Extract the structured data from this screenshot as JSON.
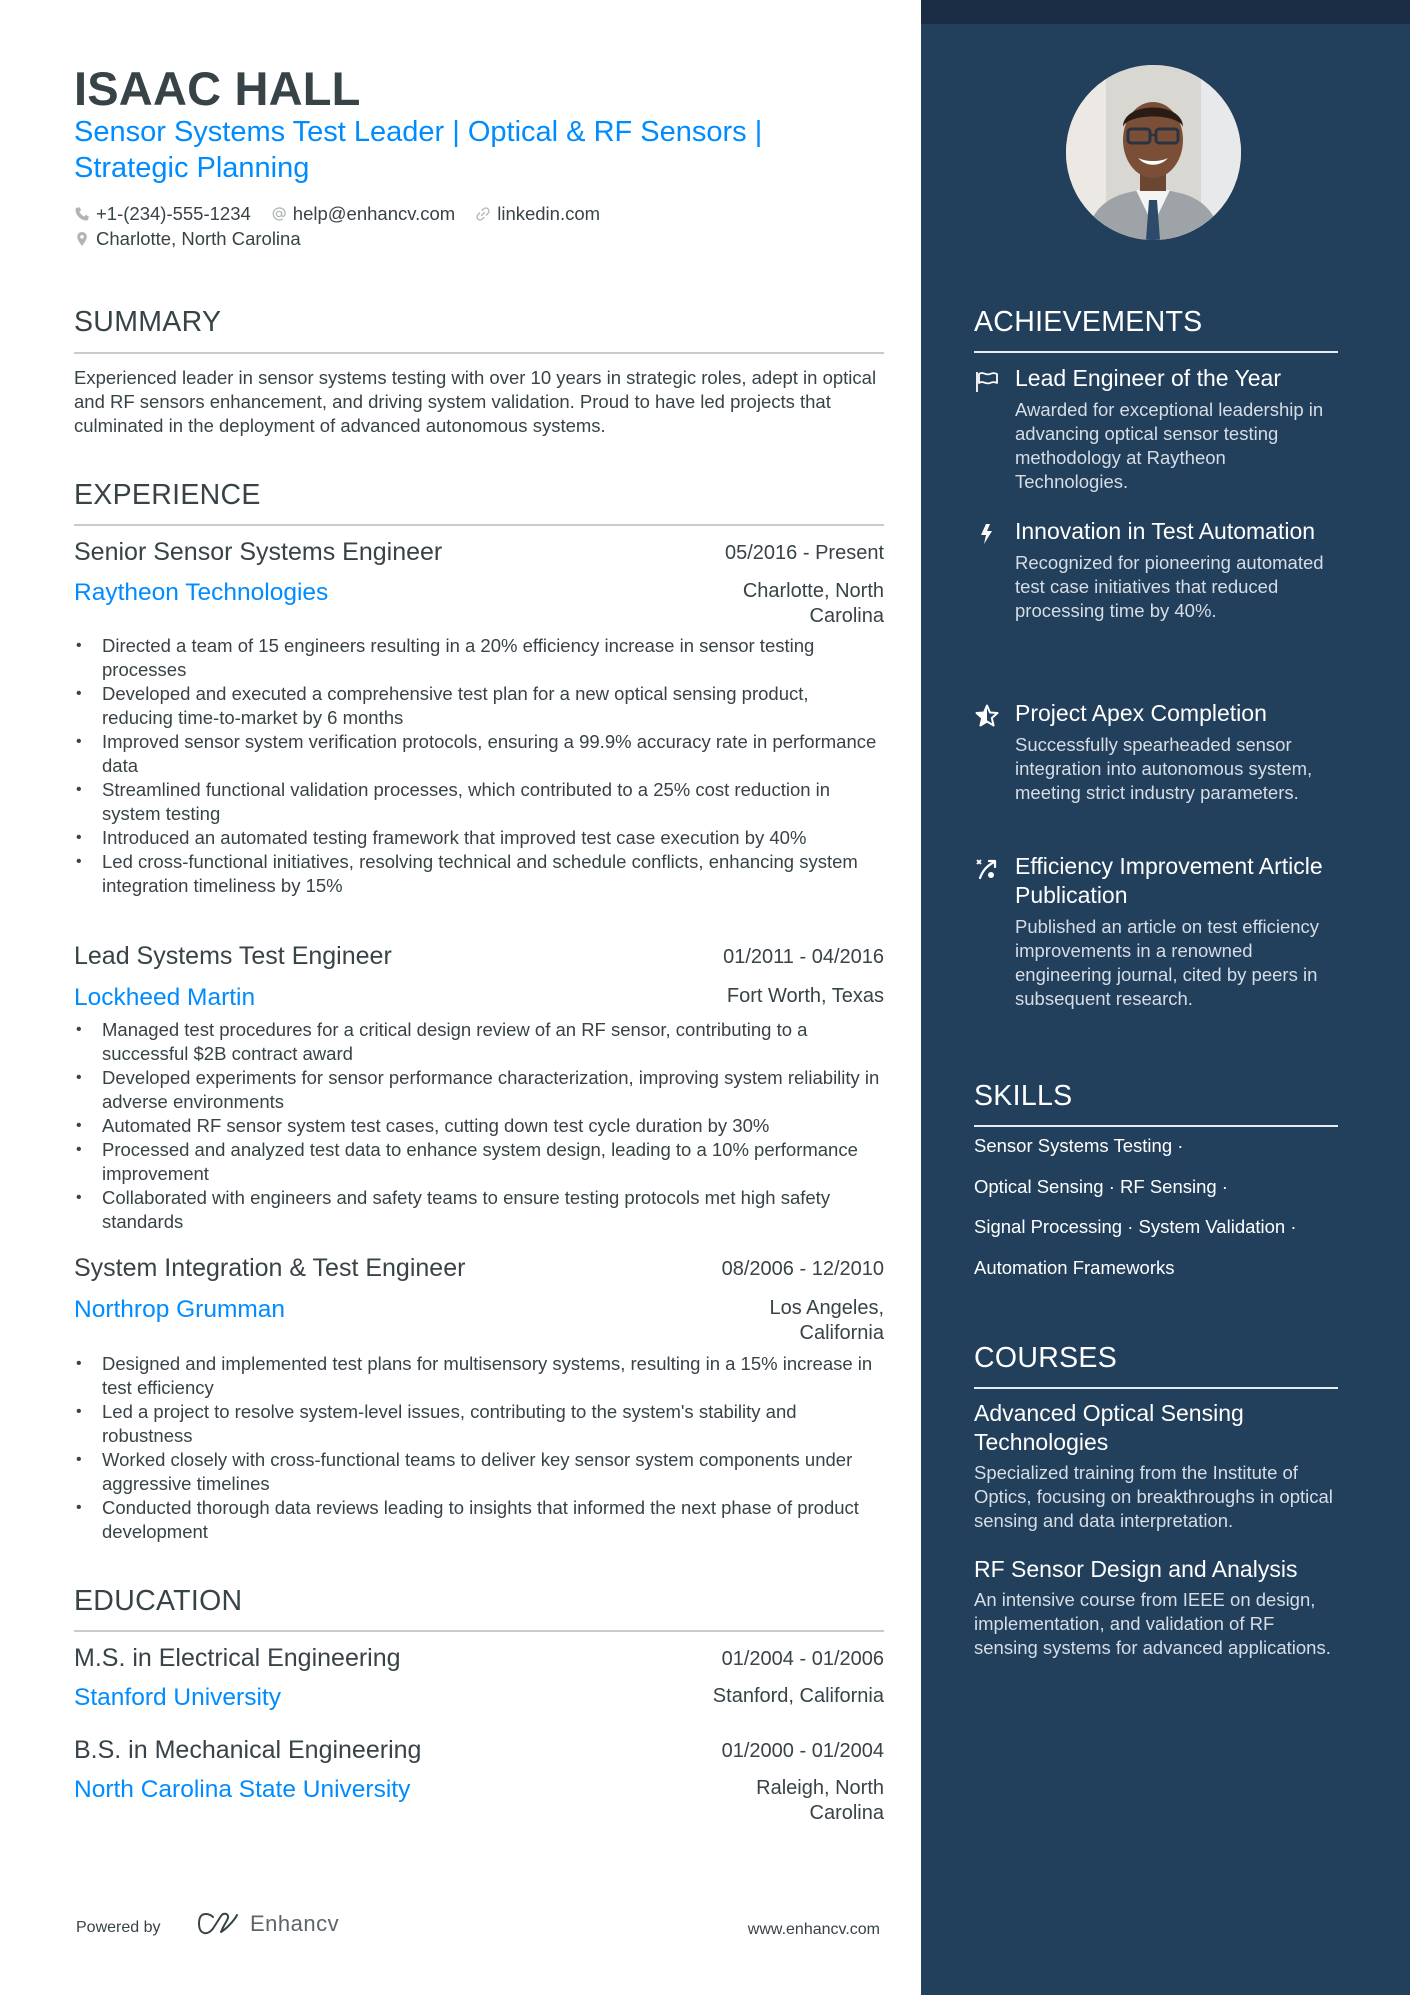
{
  "header": {
    "name": "ISAAC HALL",
    "headline": "Sensor Systems Test Leader | Optical & RF Sensors | Strategic Planning",
    "phone": "+1-(234)-555-1234",
    "email": "help@enhancv.com",
    "website": "linkedin.com",
    "location": "Charlotte, North Carolina",
    "icons": {
      "phone": "phone-icon",
      "email": "at-icon",
      "website": "link-icon",
      "location": "map-pin-icon"
    }
  },
  "summary": {
    "title": "SUMMARY",
    "text": "Experienced leader in sensor systems testing with over 10 years in strategic roles, adept in optical and RF sensors enhancement, and driving system validation. Proud to have led projects that culminated in the deployment of advanced autonomous systems."
  },
  "experience": {
    "title": "EXPERIENCE",
    "items": [
      {
        "role": "Senior Sensor Systems Engineer",
        "dates": "05/2016 - Present",
        "company": "Raytheon Technologies",
        "location": "Charlotte, North Carolina",
        "bullets": [
          "Directed a team of 15 engineers resulting in a 20% efficiency increase in sensor testing processes",
          "Developed and executed a comprehensive test plan for a new optical sensing product, reducing time-to-market by 6 months",
          "Improved sensor system verification protocols, ensuring a 99.9% accuracy rate in performance data",
          "Streamlined functional validation processes, which contributed to a 25% cost reduction in system testing",
          "Introduced an automated testing framework that improved test case execution by 40%",
          "Led cross-functional initiatives, resolving technical and schedule conflicts, enhancing system integration timeliness by 15%"
        ]
      },
      {
        "role": "Lead Systems Test Engineer",
        "dates": "01/2011 - 04/2016",
        "company": "Lockheed Martin",
        "location": "Fort Worth, Texas",
        "bullets": [
          "Managed test procedures for a critical design review of an RF sensor, contributing to a successful $2B contract award",
          "Developed experiments for sensor performance characterization, improving system reliability in adverse environments",
          "Automated RF sensor system test cases, cutting down test cycle duration by 30%",
          "Processed and analyzed test data to enhance system design, leading to a 10% performance improvement",
          "Collaborated with engineers and safety teams to ensure testing protocols met high safety standards"
        ]
      },
      {
        "role": "System Integration & Test Engineer",
        "dates": "08/2006 - 12/2010",
        "company": "Northrop Grumman",
        "location": "Los Angeles, California",
        "bullets": [
          "Designed and implemented test plans for multisensory systems, resulting in a 15% increase in test efficiency",
          "Led a project to resolve system-level issues, contributing to the system's stability and robustness",
          "Worked closely with cross-functional teams to deliver key sensor system components under aggressive timelines",
          "Conducted thorough data reviews leading to insights that informed the next phase of product development"
        ]
      }
    ]
  },
  "education": {
    "title": "EDUCATION",
    "items": [
      {
        "degree": "M.S. in Electrical Engineering",
        "dates": "01/2004 - 01/2006",
        "school": "Stanford University",
        "location": "Stanford, California"
      },
      {
        "degree": "B.S. in Mechanical Engineering",
        "dates": "01/2000 - 01/2004",
        "school": "North Carolina State University",
        "location": "Raleigh, North Carolina"
      }
    ]
  },
  "footer": {
    "powered_by": "Powered by",
    "brand": "Enhancv",
    "url": "www.enhancv.com"
  },
  "sidebar": {
    "achievements": {
      "title": "ACHIEVEMENTS",
      "items": [
        {
          "icon": "flag-icon",
          "title": "Lead Engineer of the Year",
          "description": "Awarded for exceptional leadership in advancing optical sensor testing methodology at Raytheon Technologies."
        },
        {
          "icon": "lightning-icon",
          "title": "Innovation in Test Automation",
          "description": "Recognized for pioneering automated test case initiatives that reduced processing time by 40%."
        },
        {
          "icon": "star-icon",
          "title": "Project Apex Completion",
          "description": "Successfully spearheaded sensor integration into autonomous system, meeting strict industry parameters."
        },
        {
          "icon": "trend-arrow-icon",
          "title": "Efficiency Improvement Article Publication",
          "description": "Published an article on test efficiency improvements in a renowned engineering journal, cited by peers in subsequent research."
        }
      ]
    },
    "skills": {
      "title": "SKILLS",
      "lines": [
        "Sensor Systems Testing ·",
        "Optical Sensing · RF Sensing ·",
        "Signal Processing · System Validation ·",
        "Automation Frameworks"
      ]
    },
    "courses": {
      "title": "COURSES",
      "items": [
        {
          "title": "Advanced Optical Sensing Technologies",
          "description": "Specialized training from the Institute of Optics, focusing on breakthroughs in optical sensing and data interpretation."
        },
        {
          "title": "RF Sensor Design and Analysis",
          "description": "An intensive course from IEEE on design, implementation, and validation of RF sensing systems for advanced applications."
        }
      ]
    }
  },
  "colors": {
    "accent": "#008cff",
    "text": "#384347",
    "sidebar_bg": "#223f5c",
    "sidebar_top": "#1a2d44"
  }
}
